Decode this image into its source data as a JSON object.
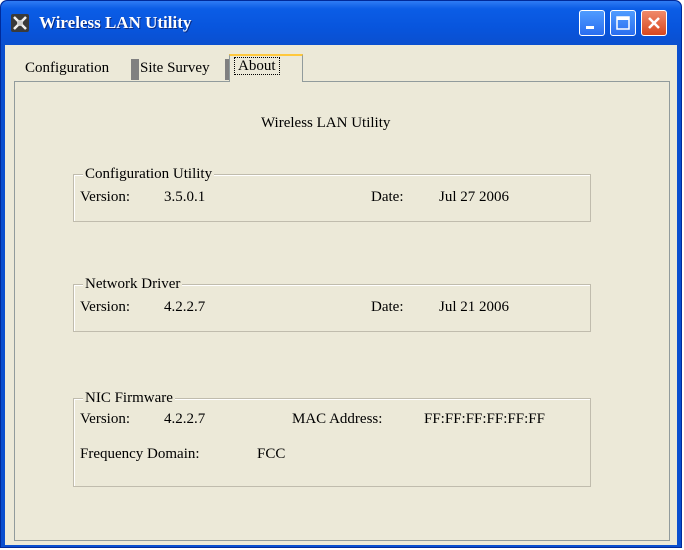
{
  "window": {
    "title": "Wireless LAN Utility"
  },
  "tabs": [
    {
      "label": "Configuration"
    },
    {
      "label": "Site Survey"
    },
    {
      "label": "About"
    }
  ],
  "about": {
    "heading": "Wireless LAN Utility",
    "config_utility": {
      "title": "Configuration Utility",
      "version_label": "Version:",
      "version": "3.5.0.1",
      "date_label": "Date:",
      "date": "Jul 27 2006"
    },
    "network_driver": {
      "title": "Network Driver",
      "version_label": "Version:",
      "version": "4.2.2.7",
      "date_label": "Date:",
      "date": "Jul 21 2006"
    },
    "nic_firmware": {
      "title": "NIC Firmware",
      "version_label": "Version:",
      "version": "4.2.2.7",
      "mac_label": "MAC Address:",
      "mac": "FF:FF:FF:FF:FF:FF",
      "freq_label": "Frequency Domain:",
      "freq": "FCC"
    }
  },
  "icons": {
    "app": "network-card-icon",
    "minimize": "minimize-icon",
    "maximize": "maximize-icon",
    "close": "close-icon"
  },
  "colors": {
    "titlebar": "#0a4fcf",
    "client_bg": "#ece9d8",
    "close_button": "#d8471f",
    "active_tab_accent": "#ffc83c"
  }
}
